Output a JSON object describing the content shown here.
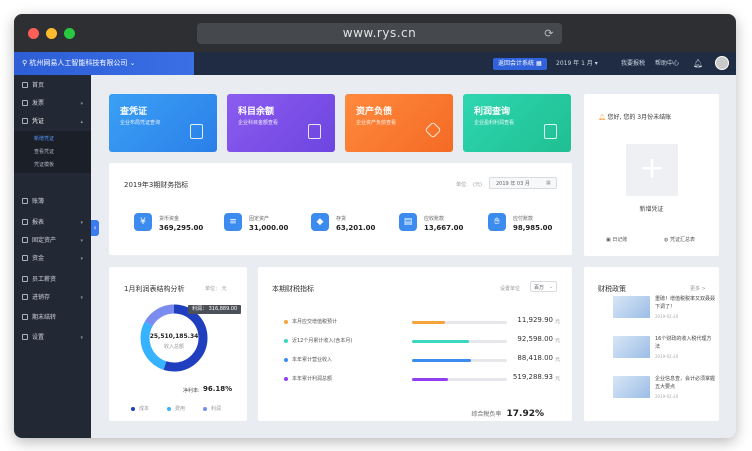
{
  "browser": {
    "url": "www.rys.cn"
  },
  "topbar": {
    "company": "杭州网易人工智能科技有限公司",
    "return_button": "返回会计系统",
    "period": "2019 年 1 月",
    "my_reports": "我要报税",
    "help": "帮助中心"
  },
  "sidebar": {
    "items": [
      {
        "label": "首页"
      },
      {
        "label": "发票"
      },
      {
        "label": "凭证"
      },
      {
        "label": "账簿"
      },
      {
        "label": "报表"
      },
      {
        "label": "固定资产"
      },
      {
        "label": "资金"
      },
      {
        "label": "员工薪资"
      },
      {
        "label": "进销存"
      },
      {
        "label": "期末结转"
      },
      {
        "label": "设置"
      }
    ],
    "subitems": [
      {
        "label": "新增凭证"
      },
      {
        "label": "查看凭证"
      },
      {
        "label": "凭证模板"
      }
    ]
  },
  "cards": [
    {
      "title": "查凭证",
      "subtitle": "企业布局凭证查询",
      "color_from": "#3aa0f5",
      "color_to": "#2b7fe8"
    },
    {
      "title": "科目余额",
      "subtitle": "企业科目金额查看",
      "color_from": "#8b5cf0",
      "color_to": "#6d45e0"
    },
    {
      "title": "资产负债",
      "subtitle": "企业资产负债查看",
      "color_from": "#ff8a3d",
      "color_to": "#f46a25"
    },
    {
      "title": "利润查询",
      "subtitle": "企业盈利利润查看",
      "color_from": "#2fd6b0",
      "color_to": "#1fbf92"
    }
  ],
  "greeting": {
    "text": "您好, 您的 3月份未结账",
    "new_voucher": "新增凭证",
    "daily_note": "日记账",
    "voucher_summary": "凭证汇总表"
  },
  "financial": {
    "title": "2019年3期财务指标",
    "unit_label": "单位:",
    "unit": "(元)",
    "period_value": "2019 年 03 月",
    "kpis": [
      {
        "label": "货币资金",
        "value": "369,295.00",
        "icon": "yen-icon"
      },
      {
        "label": "固定资产",
        "value": "31,000.00",
        "icon": "database-icon"
      },
      {
        "label": "存货",
        "value": "63,201.00",
        "icon": "box-icon"
      },
      {
        "label": "应收账款",
        "value": "13,667.00",
        "icon": "receipt-icon"
      },
      {
        "label": "应付账款",
        "value": "98,985.00",
        "icon": "hand-coin-icon"
      }
    ]
  },
  "profit": {
    "title": "1月利润表结构分析",
    "unit": "单位：  元",
    "tooltip": "利润：  316,889.00",
    "center_value": "25,510,185.34",
    "center_label": "收入总额",
    "margin_label": "净利率:",
    "margin_value": "96.18%",
    "legend": [
      {
        "name": "成本",
        "color": "#1f3fbf"
      },
      {
        "name": "费用",
        "color": "#35b3ff"
      },
      {
        "name": "利润",
        "color": "#7a8cf0"
      }
    ]
  },
  "indicators": {
    "title": "本期财税指标",
    "unit_label": "设置单位",
    "unit_value": "百万",
    "rows": [
      {
        "label": "本月应交增值税预计",
        "value": "11,929.90",
        "unit": "元",
        "percent": 35,
        "color": "#f5a33a"
      },
      {
        "label": "近12个月累计收入(含本月)",
        "value": "92,598.00",
        "unit": "元",
        "percent": 60,
        "color": "#3ad8c0"
      },
      {
        "label": "本年累计营业收入",
        "value": "88,418.00",
        "unit": "元",
        "percent": 62,
        "color": "#3c8cf0"
      },
      {
        "label": "本年累计利润总额",
        "value": "519,288.93",
        "unit": "元",
        "percent": 38,
        "color": "#8e3ff0"
      }
    ],
    "tax_label": "综合税负率",
    "tax_value": "17.92%"
  },
  "policy": {
    "title": "财税政策",
    "more": "更多 >",
    "news": [
      {
        "title": "重磅！增值税税率又双叒叕下调了！",
        "date": "2019-02-20"
      },
      {
        "title": "16个财政的收入税代理方法",
        "date": "2019-02-20"
      },
      {
        "title": "企业信息查，会计必须掌握五大要点",
        "date": "2019-02-20"
      }
    ]
  }
}
